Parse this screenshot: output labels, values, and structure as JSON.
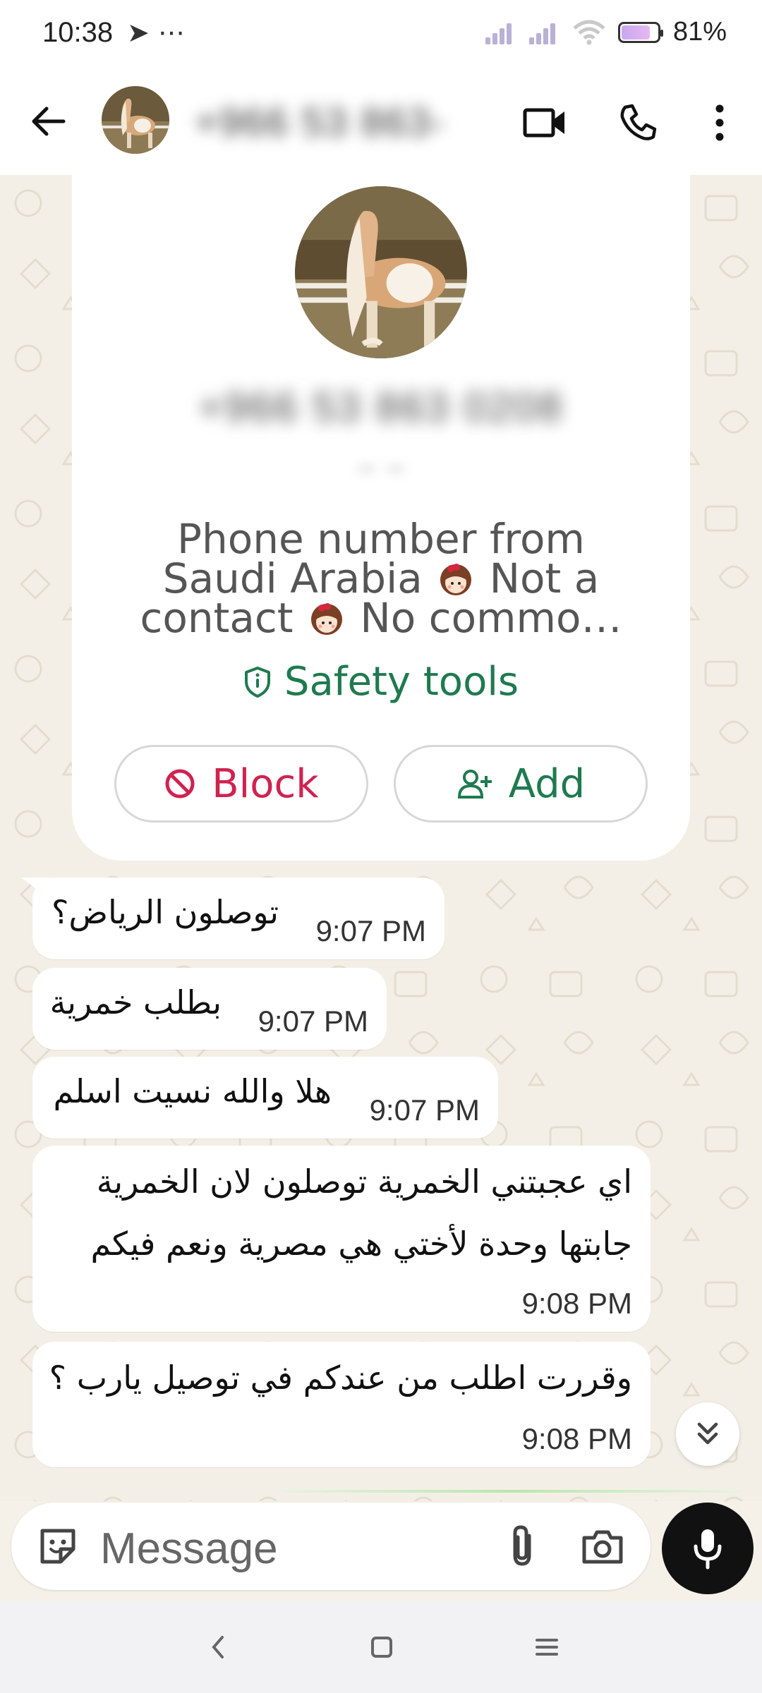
{
  "status_bar": {
    "time": "10:38",
    "left_icons": "➤ ⋯",
    "battery": "81%"
  },
  "header": {
    "contact_name": "+966 53 863-",
    "icons": [
      "back-arrow-icon",
      "video-call-icon",
      "phone-icon",
      "more-vert-icon"
    ]
  },
  "info_card": {
    "number": "+966 53 863 0208",
    "sub": "~ ~",
    "line1": "Phone number from",
    "line2": "Saudi Arabia",
    "line2b": "Not a",
    "line3": "contact",
    "line3b": "No commo…",
    "safety_label": "Safety tools",
    "block_label": "Block",
    "add_label": "Add"
  },
  "messages": [
    {
      "text": "توصلون الرياض؟",
      "time": "9:07 PM"
    },
    {
      "text": "بطلب خمرية",
      "time": "9:07 PM"
    },
    {
      "text": "هلا والله نسيت اسلم",
      "time": "9:07 PM"
    },
    {
      "text_line1": "اي عجبتني الخمرية توصلون لان الخمرية",
      "text_line2": "جابتها وحدة لأختي هي مصرية ونعم فيكم",
      "time": "9:08 PM"
    },
    {
      "text": "وقررت اطلب من عندكم في توصيل يارب ؟",
      "time": "9:08 PM"
    }
  ],
  "composer": {
    "placeholder": "Message"
  },
  "colors": {
    "accent_green": "#1f7a4f",
    "block_red": "#d1224f",
    "wallpaper": "#f4efe6"
  }
}
